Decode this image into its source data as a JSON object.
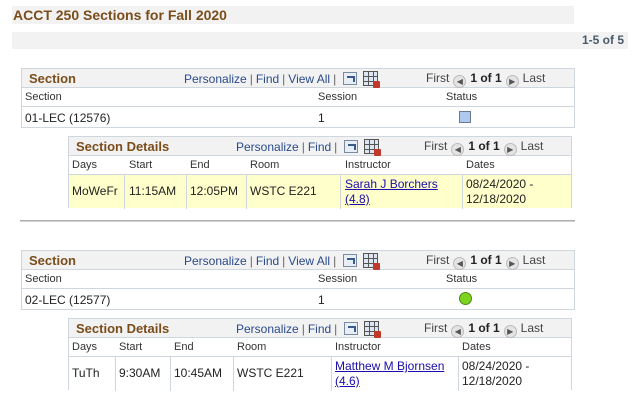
{
  "page": {
    "title": "ACCT 250 Sections for Fall 2020",
    "count": "1-5 of 5"
  },
  "toolbar": {
    "personalize": "Personalize",
    "find": "Find",
    "view_all": "View All",
    "first": "First",
    "last": "Last",
    "prev_icon": "chevron-left-icon",
    "next_icon": "chevron-right-icon"
  },
  "sections": [
    {
      "grid_title": "Section",
      "pager": "1 of 1",
      "headers": {
        "section": "Section",
        "session": "Session",
        "status": "Status"
      },
      "section_value": "01-LEC (12576)",
      "session_value": "1",
      "status_icon": "closed-square-icon",
      "details": {
        "grid_title": "Section Details",
        "pager": "1 of 1",
        "headers": {
          "days": "Days",
          "start": "Start",
          "end": "End",
          "room": "Room",
          "instructor": "Instructor",
          "dates": "Dates"
        },
        "days": "MoWeFr",
        "start": "11:15AM",
        "end": "12:05PM",
        "room": "WSTC E221",
        "instructor_name": "Sarah J Borchers",
        "instructor_rating": "(4.8)",
        "date_start": "08/24/2020 -",
        "date_end": "12/18/2020"
      }
    },
    {
      "grid_title": "Section",
      "pager": "1 of 1",
      "headers": {
        "section": "Section",
        "session": "Session",
        "status": "Status"
      },
      "section_value": "02-LEC (12577)",
      "session_value": "1",
      "status_icon": "open-circle-icon",
      "details": {
        "grid_title": "Section Details",
        "pager": "1 of 1",
        "headers": {
          "days": "Days",
          "start": "Start",
          "end": "End",
          "room": "Room",
          "instructor": "Instructor",
          "dates": "Dates"
        },
        "days": "TuTh",
        "start": "9:30AM",
        "end": "10:45AM",
        "room": "WSTC E221",
        "instructor_name": "Matthew M Bjornsen",
        "instructor_rating": "(4.6)",
        "date_start": "08/24/2020 -",
        "date_end": "12/18/2020"
      }
    }
  ],
  "colors": {
    "title_brown": "#7a4d1b",
    "highlight_row": "#ffffcc",
    "link_blue": "#1a0dab",
    "open_green": "#7ed321",
    "closed_blue": "#aec8ef"
  }
}
